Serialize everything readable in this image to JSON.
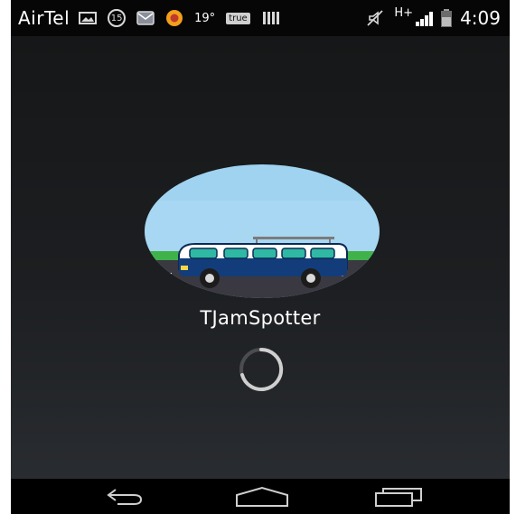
{
  "status_bar": {
    "carrier": "AirTel",
    "notification_count": "15",
    "temperature": "19°",
    "true_badge": "true",
    "network_type": "H+",
    "time": "4:09",
    "icons": [
      "image-icon",
      "notification-count-icon",
      "mail-icon",
      "app-icon",
      "true-app-icon",
      "barcode-icon",
      "mute-icon",
      "signal-icon",
      "battery-icon"
    ]
  },
  "app": {
    "name": "TJamSpotter",
    "logo": "van-on-road-logo",
    "loading": true
  },
  "nav_bar": {
    "buttons": [
      "back-icon",
      "home-icon",
      "recent-apps-icon"
    ]
  },
  "colors": {
    "background": "#151618",
    "logo_sky": "#9fd3f0",
    "logo_grass": "#3fb34a",
    "logo_road": "#3a3840",
    "van_body": "#123d7a",
    "spinner": "#cfcfcf"
  }
}
